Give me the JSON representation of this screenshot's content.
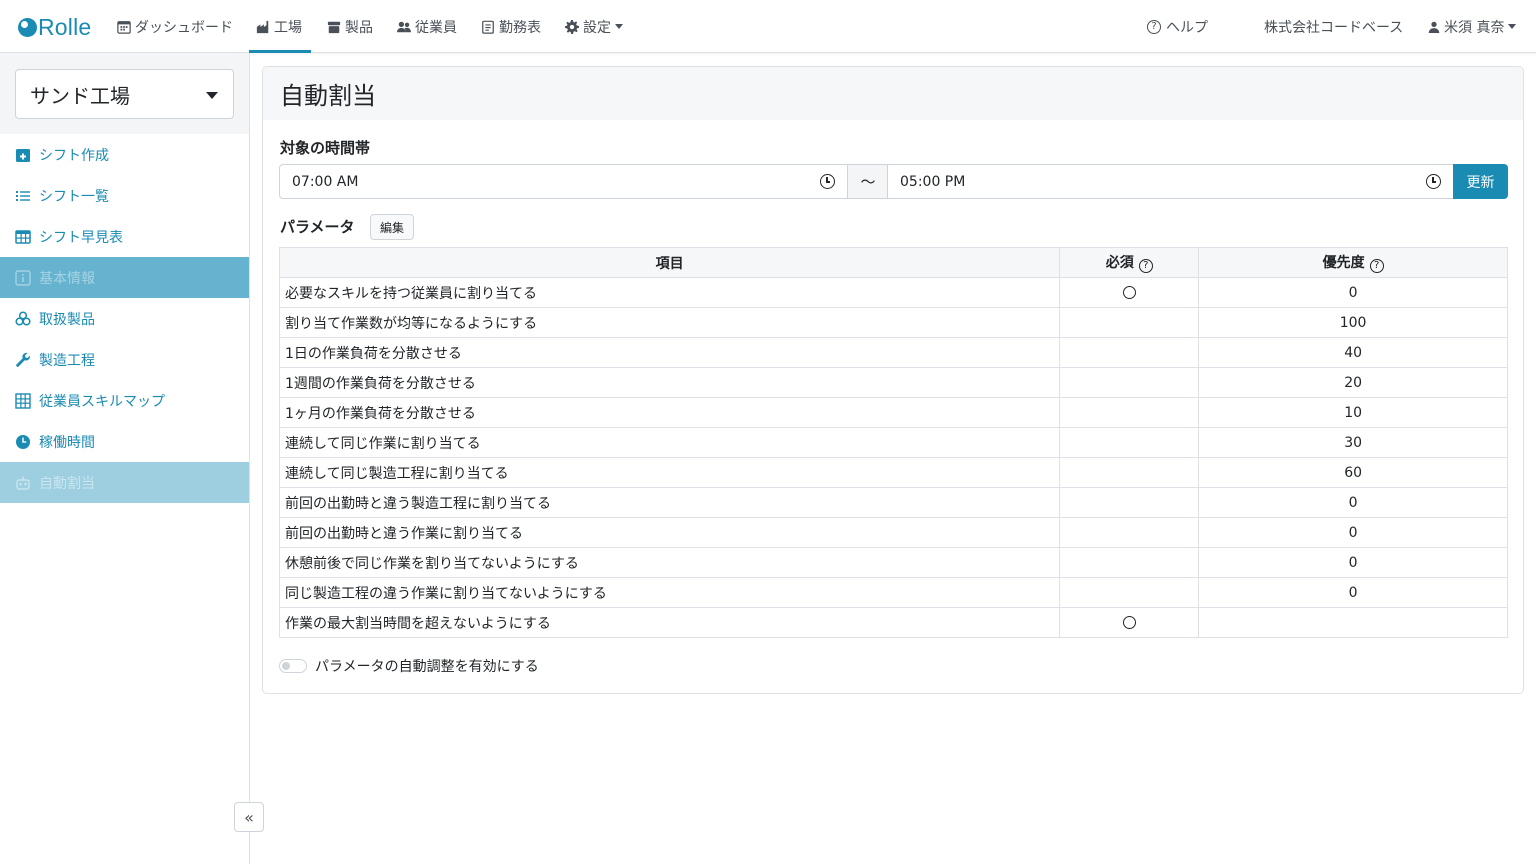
{
  "brand": "Rolle",
  "colors": {
    "accent": "#1a8bb3",
    "sidebar_header_bg": "#66b3cf",
    "sidebar_active_bg": "#9dcfe0"
  },
  "nav": {
    "items": [
      {
        "label": "ダッシュボード",
        "icon": "calendar-icon"
      },
      {
        "label": "工場",
        "icon": "factory-icon",
        "active": true
      },
      {
        "label": "製品",
        "icon": "box-icon"
      },
      {
        "label": "従業員",
        "icon": "users-icon"
      },
      {
        "label": "勤務表",
        "icon": "clipboard-icon"
      },
      {
        "label": "設定",
        "icon": "gear-icon"
      }
    ],
    "help": "ヘルプ",
    "company": "株式会社コードベース",
    "user": "米須 真奈"
  },
  "sidebar": {
    "factory": "サンド工場",
    "items": [
      {
        "label": "シフト作成",
        "icon": "calendar-plus-icon"
      },
      {
        "label": "シフト一覧",
        "icon": "list-icon"
      },
      {
        "label": "シフト早見表",
        "icon": "table-icon"
      },
      {
        "label": "基本情報",
        "icon": "info-icon",
        "type": "header"
      },
      {
        "label": "取扱製品",
        "icon": "cubes-icon"
      },
      {
        "label": "製造工程",
        "icon": "wrench-icon"
      },
      {
        "label": "従業員スキルマップ",
        "icon": "grid-icon"
      },
      {
        "label": "稼働時間",
        "icon": "clock-icon"
      },
      {
        "label": "自動割当",
        "icon": "robot-icon",
        "active": true
      }
    ],
    "collapse_label": "«"
  },
  "main": {
    "title": "自動割当",
    "time_label": "対象の時間帯",
    "start_time": "07:00 AM",
    "tilde": "〜",
    "end_time": "05:00 PM",
    "update_label": "更新",
    "params_label": "パラメータ",
    "edit_label": "編集",
    "table": {
      "headers": [
        "項目",
        "必須",
        "優先度"
      ],
      "help_glyph": "?",
      "rows": [
        {
          "item": "必要なスキルを持つ従業員に割り当てる",
          "required": true,
          "priority": "0"
        },
        {
          "item": "割り当て作業数が均等になるようにする",
          "required": false,
          "priority": "100"
        },
        {
          "item": "1日の作業負荷を分散させる",
          "required": false,
          "priority": "40"
        },
        {
          "item": "1週間の作業負荷を分散させる",
          "required": false,
          "priority": "20"
        },
        {
          "item": "1ヶ月の作業負荷を分散させる",
          "required": false,
          "priority": "10"
        },
        {
          "item": "連続して同じ作業に割り当てる",
          "required": false,
          "priority": "30"
        },
        {
          "item": "連続して同じ製造工程に割り当てる",
          "required": false,
          "priority": "60"
        },
        {
          "item": "前回の出勤時と違う製造工程に割り当てる",
          "required": false,
          "priority": "0"
        },
        {
          "item": "前回の出勤時と違う作業に割り当てる",
          "required": false,
          "priority": "0"
        },
        {
          "item": "休憩前後で同じ作業を割り当てないようにする",
          "required": false,
          "priority": "0"
        },
        {
          "item": "同じ製造工程の違う作業に割り当てないようにする",
          "required": false,
          "priority": "0"
        },
        {
          "item": "作業の最大割当時間を超えないようにする",
          "required": true,
          "priority": ""
        }
      ]
    },
    "auto_adjust_label": "パラメータの自動調整を有効にする",
    "auto_adjust_enabled": false
  }
}
